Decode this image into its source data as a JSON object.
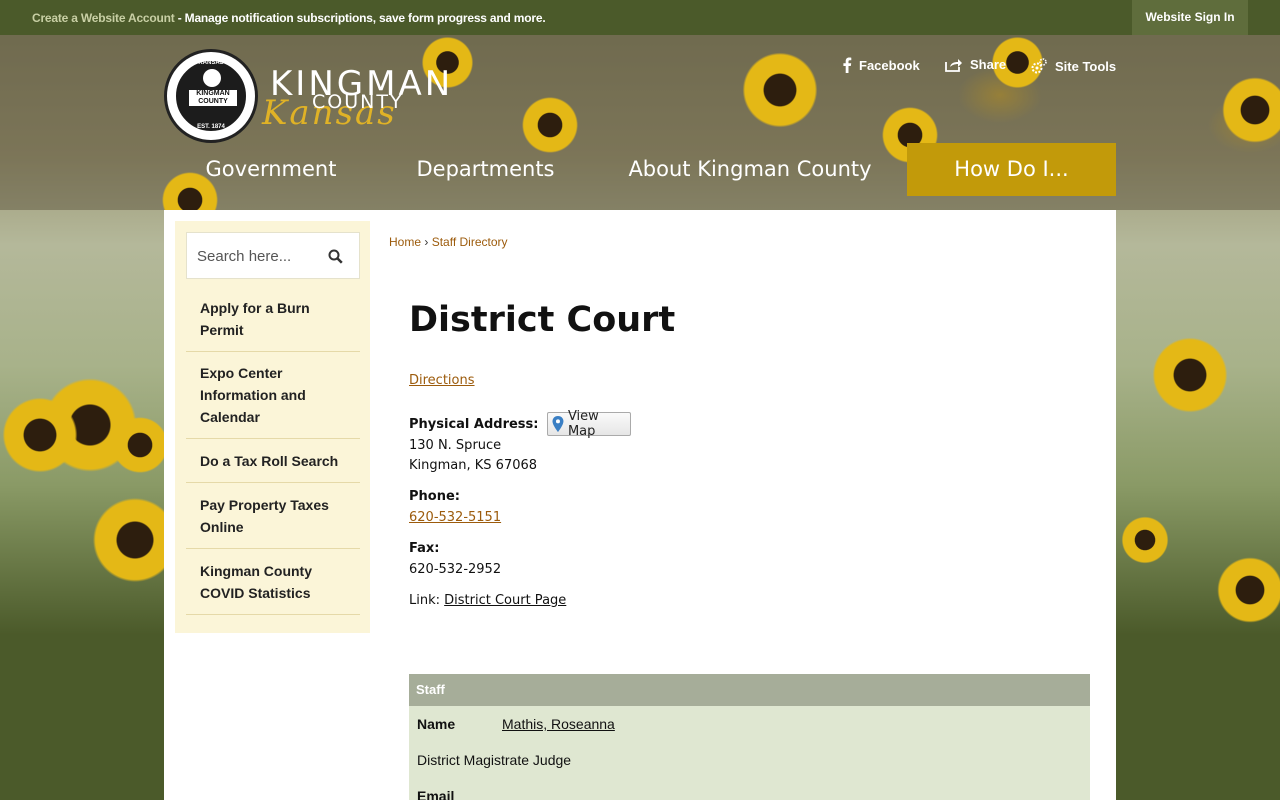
{
  "topbar": {
    "create_account": "Create a Website Account",
    "message": " - Manage notification subscriptions, save form progress and more.",
    "signin": "Website Sign In"
  },
  "logo": {
    "seal_top": "KANSAS",
    "seal_mid": "KINGMAN COUNTY",
    "seal_bottom": "EST. 1874",
    "word1": "KINGMAN",
    "word2": "COUNTY",
    "word3": "Kansas"
  },
  "header_links": [
    {
      "label": "Facebook",
      "icon": "facebook-icon"
    },
    {
      "label": "Share",
      "icon": "share-icon"
    },
    {
      "label": "Site Tools",
      "icon": "gear-icon"
    }
  ],
  "nav": [
    "Government",
    "Departments",
    "About Kingman County",
    "How Do I..."
  ],
  "colors": {
    "accent": "#c29a0a",
    "dark_green": "#4b5a2a",
    "link": "#9c5b0c",
    "sidebar": "#fbf5d8",
    "staff_head": "#a6ad99",
    "staff_body": "#dfe7d1"
  },
  "search": {
    "placeholder": "Search here..."
  },
  "sidebar": [
    "Apply for a Burn Permit",
    "Expo Center Information and Calendar",
    "Do a Tax Roll Search",
    "Pay Property Taxes Online",
    "Kingman County COVID Statistics"
  ],
  "breadcrumb": {
    "home": "Home",
    "sep": " › ",
    "current": "Staff Directory"
  },
  "page": {
    "title": "District Court",
    "directions": "Directions",
    "address_label": "Physical Address:",
    "view_map": "View Map",
    "address1": "130 N. Spruce",
    "address2": "Kingman, KS 67068",
    "phone_label": "Phone:",
    "phone": "620-532-5151",
    "fax_label": "Fax:",
    "fax": "620-532-2952",
    "link_label": "Link: ",
    "link_text": "District Court Page"
  },
  "staff": {
    "header": "Staff",
    "name_label": "Name",
    "name": "Mathis, Roseanna",
    "title": "District Magistrate Judge",
    "email_label": "Email"
  }
}
